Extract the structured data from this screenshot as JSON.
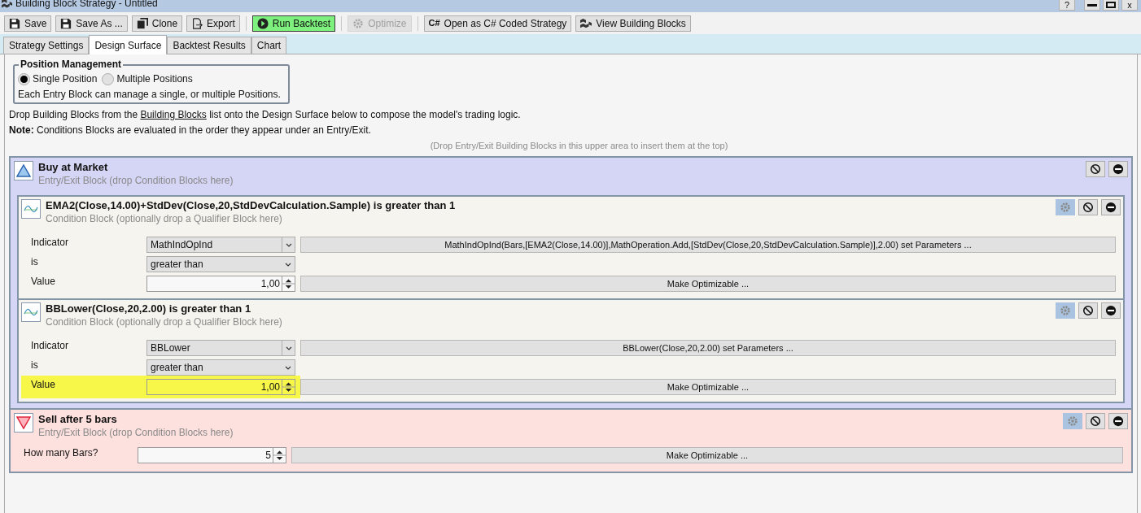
{
  "window": {
    "title": "Building Block Strategy - Untitled",
    "help": "?",
    "close": "x"
  },
  "toolbar_groups": [
    [
      {
        "label": "Save",
        "disabled": false,
        "highlighted": false
      },
      {
        "label": "Save As ...",
        "disabled": false,
        "highlighted": false
      },
      {
        "label": "Clone",
        "disabled": false,
        "highlighted": false
      },
      {
        "label": "Export",
        "disabled": false,
        "highlighted": false
      }
    ],
    [
      {
        "label": "Run Backtest",
        "disabled": false,
        "highlighted": true
      }
    ],
    [
      {
        "label": "Optimize",
        "disabled": true,
        "highlighted": false
      }
    ],
    [
      {
        "label": "Open as C# Coded Strategy",
        "disabled": false,
        "highlighted": false,
        "icon_text": "C#"
      },
      {
        "label": "View Building Blocks",
        "disabled": false,
        "highlighted": false
      }
    ]
  ],
  "tabs": [
    {
      "label": "Strategy Settings",
      "selected": false
    },
    {
      "label": "Design Surface",
      "selected": true
    },
    {
      "label": "Backtest Results",
      "selected": false
    },
    {
      "label": "Chart",
      "selected": false
    }
  ],
  "position_management": {
    "title": "Position Management",
    "options": [
      {
        "label": "Single Position",
        "selected": true
      },
      {
        "label": "Multiple Positions",
        "selected": false
      }
    ],
    "note": "Each Entry Block can manage a single, or multiple Positions."
  },
  "instructions": {
    "before": "Drop Building Blocks from the",
    "link": "Building Blocks",
    "after": "list onto the Design Surface below to compose the model's trading logic."
  },
  "note": "**Note:** Conditions Blocks are evaluated in the order they appear under an Entry/Exit.",
  "drop_hint": "(Drop Entry/Exit Building Blocks in this upper area to insert them at the top)",
  "blocks": [
    {
      "kind": "buy",
      "title": "Buy at Market",
      "subtitle": "Entry/Exit Block (drop Condition Blocks here)",
      "settings": false,
      "conditions": [
        {
          "title": "EMA2(Close,14.00)+StdDev(Close,20,StdDevCalculation.Sample) is greater than 1",
          "subtitle": "Condition Block (optionally drop a Qualifier Block here)",
          "rows": [
            {
              "label": "Indicator",
              "kind": "dropdown",
              "value": "MathIndOpInd",
              "button": "MathIndOpInd(Bars,[EMA2(Close,14.00)],MathOperation.Add,[StdDev(Close,20,StdDevCalculation.Sample)],2.00) set Parameters ...",
              "highlighted": false
            },
            {
              "label": "is",
              "kind": "combo",
              "value": "greater than",
              "highlighted": false
            },
            {
              "label": "Value",
              "kind": "spin",
              "value": "1,00",
              "button": "Make Optimizable ...",
              "highlighted": false
            }
          ]
        },
        {
          "title": "BBLower(Close,20,2.00) is greater than 1",
          "subtitle": "Condition Block (optionally drop a Qualifier Block here)",
          "rows": [
            {
              "label": "Indicator",
              "kind": "dropdown",
              "value": "BBLower",
              "button": "BBLower(Close,20,2.00) set Parameters ...",
              "highlighted": false
            },
            {
              "label": "is",
              "kind": "combo",
              "value": "greater than",
              "highlighted": false
            },
            {
              "label": "Value",
              "kind": "spin",
              "value": "1,00",
              "button": "Make Optimizable ...",
              "highlighted": true
            }
          ]
        }
      ]
    },
    {
      "kind": "sell",
      "title": "Sell after 5 bars",
      "subtitle": "Entry/Exit Block (drop Condition Blocks here)",
      "settings": true,
      "rows": [
        {
          "label": "How many Bars?",
          "kind": "spin",
          "value": "5",
          "button": "Make Optimizable ...",
          "highlighted": false
        }
      ]
    }
  ]
}
